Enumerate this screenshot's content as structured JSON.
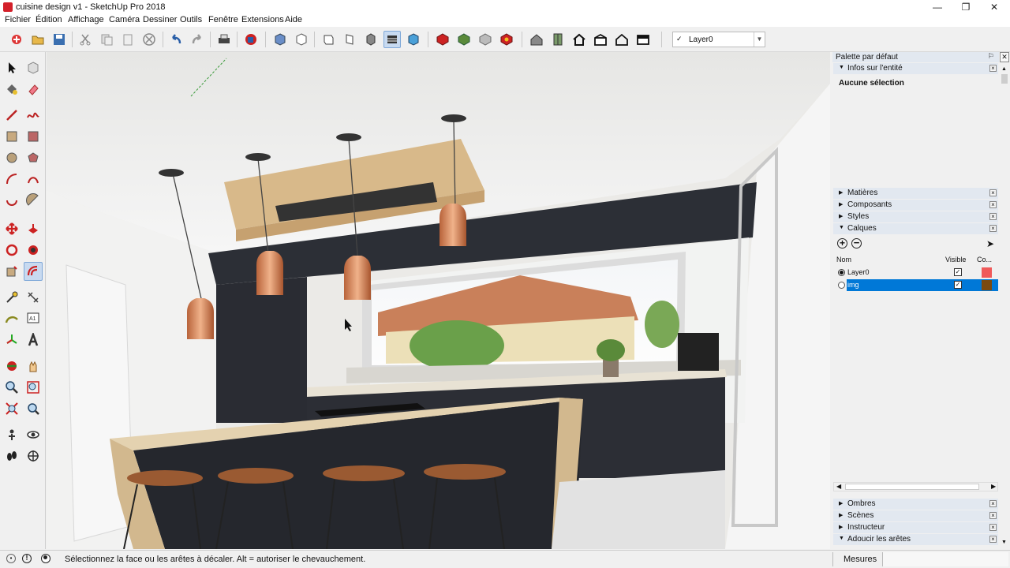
{
  "window": {
    "title": "cuisine design v1 - SketchUp Pro 2018",
    "minimize_icon": "minimize-icon",
    "maximize_icon": "maximize-icon",
    "close_icon": "close-icon"
  },
  "menu": [
    "Fichier",
    "Édition",
    "Affichage",
    "Caméra",
    "Dessiner",
    "Outils",
    "Fenêtre",
    "Extensions",
    "Aide"
  ],
  "toolbar": {
    "layer_selected": "Layer0",
    "icons": [
      "new",
      "open",
      "save",
      "cut",
      "copy",
      "paste",
      "erase",
      "undo",
      "redo",
      "print",
      "model-info",
      "iso",
      "top",
      "front",
      "right",
      "back",
      "left",
      "style-xray",
      "style-wire",
      "style-hidden",
      "style-shaded",
      "style-texture",
      "3d-warehouse",
      "share-model",
      "share-component",
      "extension-warehouse",
      "section",
      "layout",
      "house",
      "house-roof",
      "house-outline",
      "section-fill"
    ]
  },
  "left_tools": [
    "select",
    "make-component",
    "paint",
    "eraser",
    "line",
    "freehand",
    "rectangle",
    "rotated-rect",
    "circle",
    "polygon",
    "arc",
    "arc-2pt",
    "arc-3pt",
    "pie",
    "move",
    "push-pull",
    "rotate",
    "follow-me",
    "scale",
    "offset",
    "tape",
    "dimension",
    "protractor",
    "text",
    "axes",
    "3d-text",
    "orbit",
    "pan",
    "zoom",
    "zoom-window",
    "zoom-extents",
    "previous",
    "position-camera",
    "look-around",
    "walk",
    "section-plane"
  ],
  "palette": {
    "title": "Palette par défaut",
    "entity_info": {
      "header": "Infos sur l'entité",
      "selection": "Aucune sélection"
    },
    "collapsed": [
      "Matières",
      "Composants",
      "Styles"
    ],
    "layers": {
      "header": "Calques",
      "columns": {
        "name": "Nom",
        "visible": "Visible",
        "color": "Co..."
      },
      "rows": [
        {
          "name": "Layer0",
          "active": true,
          "visible": true,
          "color": "#f05a5a",
          "selected": false
        },
        {
          "name": "img",
          "active": false,
          "visible": true,
          "color": "#7a4a10",
          "selected": true
        }
      ]
    },
    "bottom": [
      "Ombres",
      "Scènes",
      "Instructeur",
      "Adoucir les arêtes"
    ]
  },
  "status": {
    "message": "Sélectionnez la face ou les arêtes à décaler. Alt = autoriser le chevauchement.",
    "measure_label": "Mesures"
  },
  "colors": {
    "accent": "#0078d7",
    "selection": "#0078d7"
  }
}
